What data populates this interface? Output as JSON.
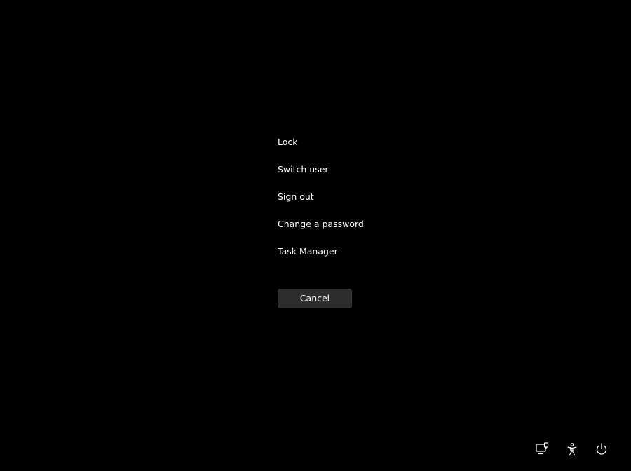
{
  "menu": {
    "items": [
      {
        "id": "lock",
        "label": "Lock"
      },
      {
        "id": "switch-user",
        "label": "Switch user"
      },
      {
        "id": "sign-out",
        "label": "Sign out"
      },
      {
        "id": "change-password",
        "label": "Change a password"
      },
      {
        "id": "task-manager",
        "label": "Task Manager"
      }
    ]
  },
  "cancel": {
    "label": "Cancel"
  },
  "tray": {
    "icons": [
      "network-icon",
      "accessibility-icon",
      "power-icon"
    ]
  },
  "colors": {
    "background": "#000000",
    "text": "#ffffff",
    "button_bg": "#2d2d2d"
  }
}
